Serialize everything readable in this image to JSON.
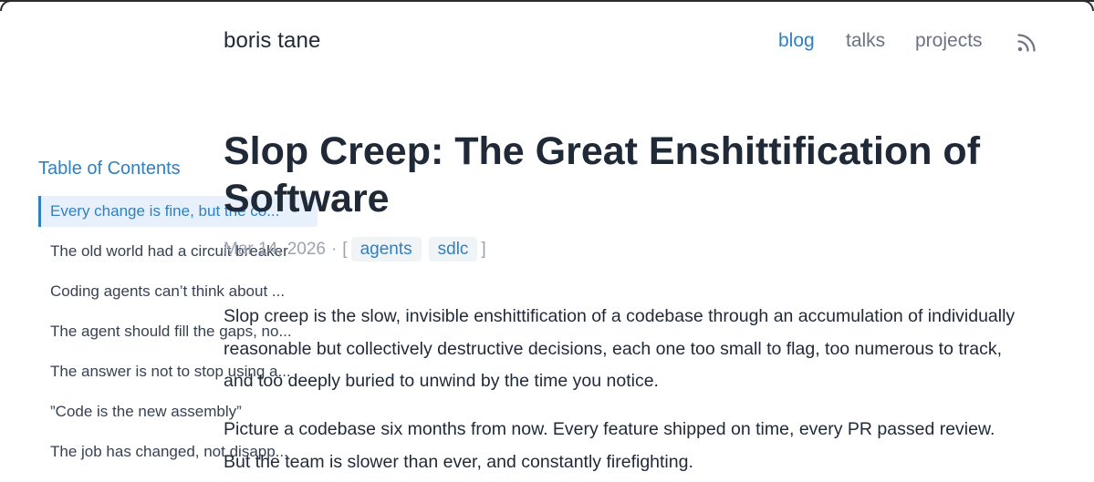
{
  "header": {
    "site_name": "boris tane",
    "nav": [
      {
        "label": "blog",
        "active": true
      },
      {
        "label": "talks",
        "active": false
      },
      {
        "label": "projects",
        "active": false
      }
    ],
    "rss_icon": "rss-icon"
  },
  "toc": {
    "title": "Table of Contents",
    "items": [
      {
        "label": "Every change is fine, but the co...",
        "active": true
      },
      {
        "label": "The old world had a circuit breaker",
        "active": false
      },
      {
        "label": "Coding agents can’t think about ...",
        "active": false
      },
      {
        "label": "The agent should fill the gaps, no...",
        "active": false
      },
      {
        "label": "The answer is not to stop using a...",
        "active": false
      },
      {
        "label": "”Code is the new assembly”",
        "active": false
      },
      {
        "label": "The job has changed, not disapp...",
        "active": false
      }
    ]
  },
  "article": {
    "title": "Slop Creep: The Great Enshittification of Software",
    "date": "Mar 14, 2026",
    "meta_separator": "·",
    "bracket_open": "[",
    "bracket_close": "]",
    "tags": [
      "agents",
      "sdlc"
    ],
    "paragraphs": [
      "Slop creep is the slow, invisible enshittification of a codebase through an accumulation of individually reasonable but collectively destructive decisions, each one too small to flag, too numerous to track, and too deeply buried to unwind by the time you notice.",
      "Picture a codebase six months from now. Every feature shipped on time, every PR passed review. But the team is slower than ever, and constantly firefighting."
    ]
  },
  "colors": {
    "accent": "#2f7fc1",
    "text": "#1f2937",
    "muted": "#9ca3af",
    "nav_inactive": "#6b7280",
    "toc_active_bg": "#e8f1fb",
    "tag_bg": "#f1f4f7"
  }
}
